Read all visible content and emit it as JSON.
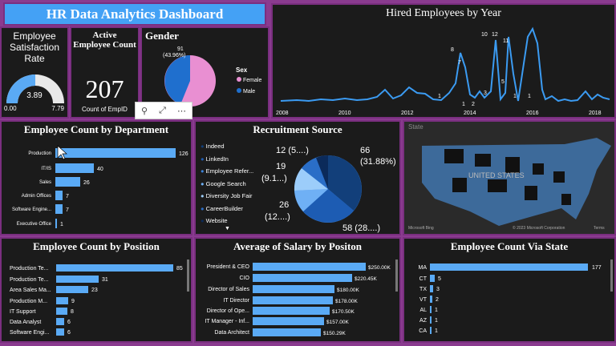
{
  "dashboard_title": "HR Data Analytics Dashboard",
  "satisfaction": {
    "title": "Employee Satisfaction Rate",
    "value": "3.89",
    "min": "0.00",
    "max": "7.79",
    "fraction": 0.5
  },
  "active": {
    "title": "Active Employee Count",
    "value": "207",
    "sublabel": "Count of EmpID"
  },
  "gender": {
    "title": "Gender",
    "legend_title": "Sex",
    "female_label": "Female",
    "male_label": "Male",
    "slice_label_1": "91",
    "slice_label_2": "(43.96%)",
    "female_color": "#e98fd2",
    "male_color": "#1f6fce"
  },
  "hired": {
    "title": "Hired Employees by Year",
    "years": [
      "2008",
      "2010",
      "2012",
      "2014",
      "2016",
      "2018"
    ],
    "peak_labels": [
      "10",
      "12",
      "8",
      "7",
      "11",
      "5",
      "3",
      "1",
      "2",
      "1",
      "1",
      "1"
    ]
  },
  "dept": {
    "title": "Employee Count by Department",
    "rows": [
      {
        "label": "Production",
        "value": "126"
      },
      {
        "label": "IT/IS",
        "value": "40"
      },
      {
        "label": "Sales",
        "value": "26"
      },
      {
        "label": "Admin Offices",
        "value": "7"
      },
      {
        "label": "Software Engine...",
        "value": "7"
      },
      {
        "label": "Executive Office",
        "value": "1"
      }
    ]
  },
  "recruit": {
    "title": "Recruitment Source",
    "legend": [
      "Indeed",
      "LinkedIn",
      "Employee Refer...",
      "Google Search",
      "Diversity Job Fair",
      "CareerBuilder",
      "Website"
    ],
    "labels": [
      "66",
      "(31.88%)",
      "58 (28....)",
      "26",
      "(12....)",
      "19",
      "(9.1...)",
      "12 (5....)"
    ]
  },
  "map": {
    "label": "State",
    "country": "UNITED STATES",
    "logo": "Microsoft Bing",
    "copyright": "© 2023 Microsoft Corporation",
    "terms": "Terms"
  },
  "position": {
    "title": "Employee Count by Position",
    "rows": [
      {
        "label": "Production Te...",
        "value": "85"
      },
      {
        "label": "Production Te...",
        "value": "31"
      },
      {
        "label": "Area Sales Ma...",
        "value": "23"
      },
      {
        "label": "Production M...",
        "value": "9"
      },
      {
        "label": "IT Support",
        "value": "8"
      },
      {
        "label": "Data Analyst",
        "value": "6"
      },
      {
        "label": "Software Engi...",
        "value": "6"
      }
    ]
  },
  "salary": {
    "title": "Average of Salary by Positon",
    "rows": [
      {
        "label": "President & CEO",
        "value": "$250.00K"
      },
      {
        "label": "CIO",
        "value": "$220.45K"
      },
      {
        "label": "Director of Sales",
        "value": "$180.00K"
      },
      {
        "label": "IT Director",
        "value": "$178.00K"
      },
      {
        "label": "Director of Ope...",
        "value": "$170.50K"
      },
      {
        "label": "IT Manager - Inf...",
        "value": "$157.00K"
      },
      {
        "label": "Data Architect",
        "value": "$150.29K"
      }
    ]
  },
  "state": {
    "title": "Employee Count Via State",
    "rows": [
      {
        "label": "MA",
        "value": "177"
      },
      {
        "label": "CT",
        "value": "5"
      },
      {
        "label": "TX",
        "value": "3"
      },
      {
        "label": "VT",
        "value": "2"
      },
      {
        "label": "AL",
        "value": "1"
      },
      {
        "label": "AZ",
        "value": "1"
      },
      {
        "label": "CA",
        "value": "1"
      }
    ]
  }
}
